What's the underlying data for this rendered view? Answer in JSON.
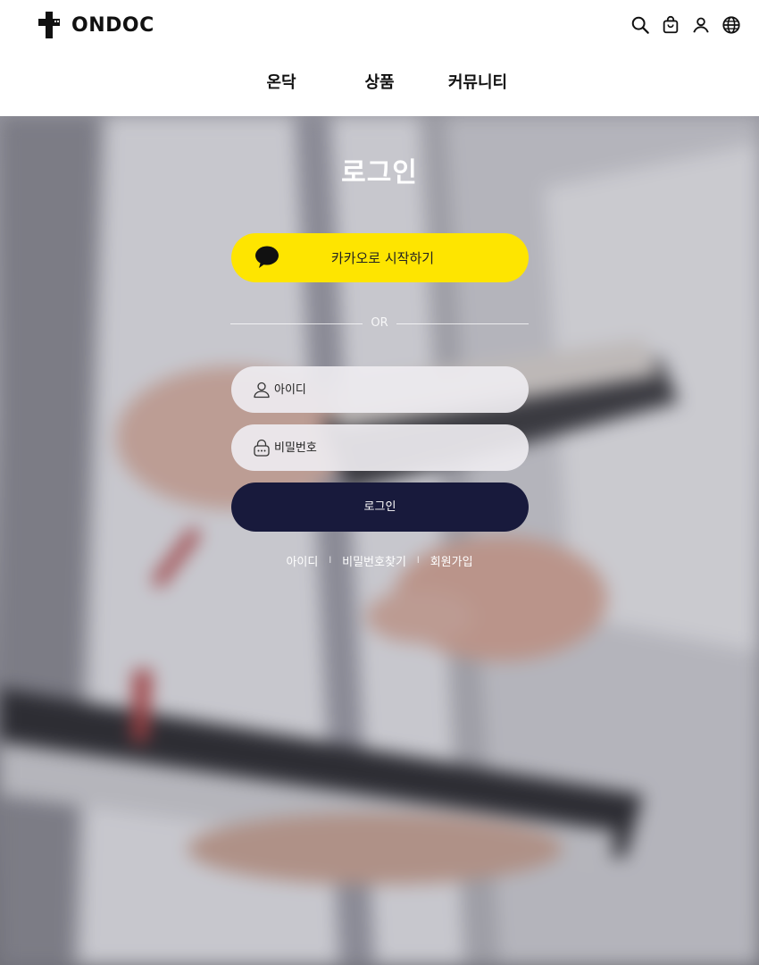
{
  "brand": {
    "name": "ONDOC"
  },
  "header": {
    "icons": [
      "search-icon",
      "shopping-bag-icon",
      "user-icon",
      "globe-icon"
    ]
  },
  "nav": {
    "items": [
      {
        "label": "온닥"
      },
      {
        "label": "상품"
      },
      {
        "label": "커뮤니티"
      }
    ]
  },
  "login": {
    "title": "로그인",
    "kakao_label": "카카오로 시작하기",
    "divider_text": "OR",
    "id_placeholder": "아이디",
    "password_placeholder": "비밀번호",
    "submit_label": "로그인",
    "links": [
      {
        "label": "아이디"
      },
      {
        "label": "비밀번호찾기"
      },
      {
        "label": "회원가입"
      }
    ],
    "link_separator": "l"
  },
  "colors": {
    "kakao": "#fee500",
    "login_button": "#181a3c",
    "text_dark": "#111111"
  }
}
